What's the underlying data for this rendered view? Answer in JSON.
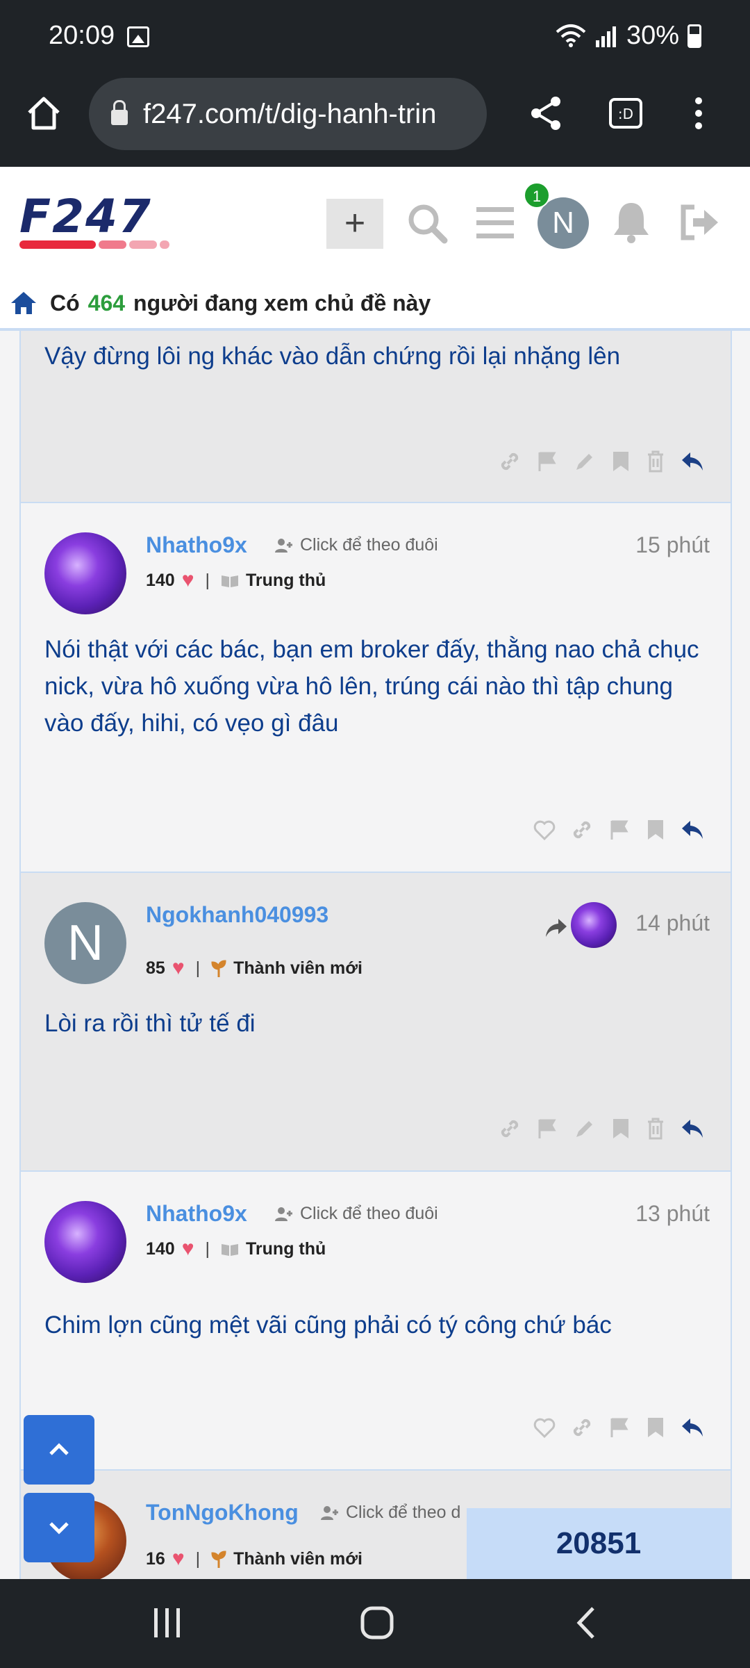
{
  "status": {
    "time": "20:09",
    "battery": "30%"
  },
  "browser": {
    "url": "f247.com/t/dig-hanh-trin"
  },
  "header": {
    "logo_text": "F247",
    "notification_count": "1",
    "avatar_letter": "N",
    "plus": "+"
  },
  "viewers": {
    "prefix": "Có",
    "count": "464",
    "suffix": "người đang xem chủ đề này"
  },
  "posts": [
    {
      "content": "Vậy đừng lôi ng khác vào dẫn chứng rồi lại nhặng lên"
    },
    {
      "username": "Nhatho9x",
      "follow": "Click để theo đuôi",
      "time": "15 phút",
      "likes": "140",
      "rank": "Trung thủ",
      "content": "Nói thật với các bác, bạn em broker đấy, thằng nao chả chục nick, vừa hô xuống vừa hô lên, trúng cái nào thì tập chung vào đấy, hihi, có vẹo gì đâu"
    },
    {
      "username": "Ngokhanh040993",
      "avatar_letter": "N",
      "time": "14 phút",
      "likes": "85",
      "rank": "Thành viên mới",
      "content": "Lòi ra rồi thì tử tế đi"
    },
    {
      "username": "Nhatho9x",
      "follow": "Click để theo đuôi",
      "time": "13 phút",
      "likes": "140",
      "rank": "Trung thủ",
      "content": "Chim lợn cũng mệt vãi cũng phải có tý công chứ bác"
    },
    {
      "username": "TonNgoKhong",
      "follow": "Click để theo d",
      "likes": "16",
      "rank": "Thành viên mới"
    }
  ],
  "counter": "20851",
  "colors": {
    "accent": "#4a8fe0",
    "content_text": "#0d3d8c",
    "bar_dark": "#1f2327",
    "counter_bg": "#c6dcf8"
  }
}
